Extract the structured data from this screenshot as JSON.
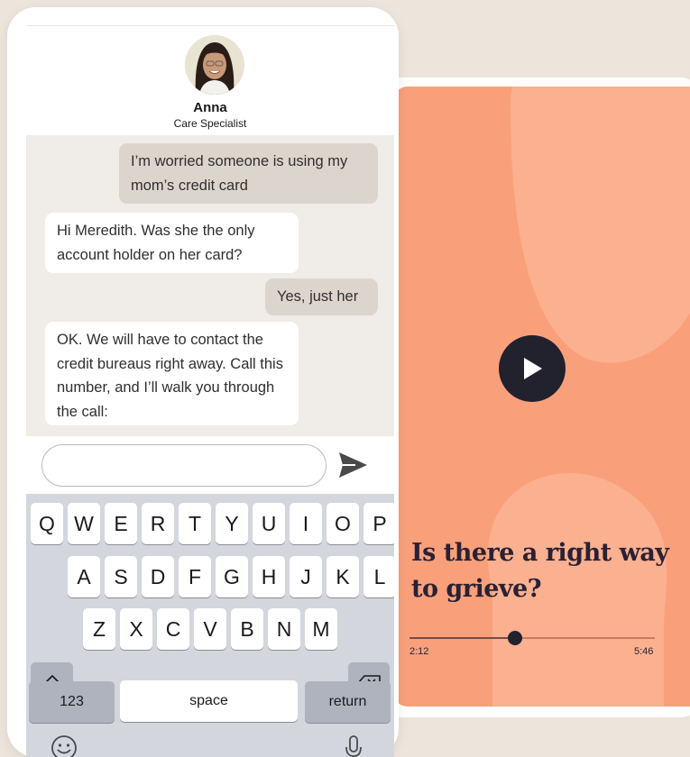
{
  "chat": {
    "agent_name": "Anna",
    "agent_role": "Care Specialist",
    "messages": [
      {
        "from": "user",
        "text": "I’m worried someone is using my mom’s credit card"
      },
      {
        "from": "agent",
        "text": "Hi Meredith. Was she the only account holder on her card?"
      },
      {
        "from": "user",
        "text": "Yes, just her"
      },
      {
        "from": "agent",
        "text": "OK. We will have to contact the credit bureaus right away. Call this number, and I’ll walk you through the call:"
      }
    ],
    "input_value": "",
    "input_placeholder": ""
  },
  "keyboard": {
    "row1": [
      "Q",
      "W",
      "E",
      "R",
      "T",
      "Y",
      "U",
      "I",
      "O",
      "P"
    ],
    "row2": [
      "A",
      "S",
      "D",
      "F",
      "G",
      "H",
      "J",
      "K",
      "L"
    ],
    "row3": [
      "Z",
      "X",
      "C",
      "V",
      "B",
      "N",
      "M"
    ],
    "numbers_label": "123",
    "space_label": "space",
    "return_label": "return"
  },
  "video": {
    "title": "Is there a right way to grieve?",
    "current_time": "2:12",
    "total_time": "5:46",
    "progress_fraction": 0.43
  },
  "colors": {
    "page_bg": "#ede5dc",
    "video_bg": "#f9a07b",
    "accent_dark": "#22212e",
    "outgoing_bubble": "#dcd5ce",
    "incoming_bubble": "#ffffff",
    "keyboard_bg": "#d3d6dd"
  },
  "icons": {
    "play": "play-icon",
    "send": "send-icon",
    "shift": "shift-icon",
    "backspace": "backspace-icon",
    "emoji": "emoji-icon",
    "microphone": "microphone-icon"
  }
}
